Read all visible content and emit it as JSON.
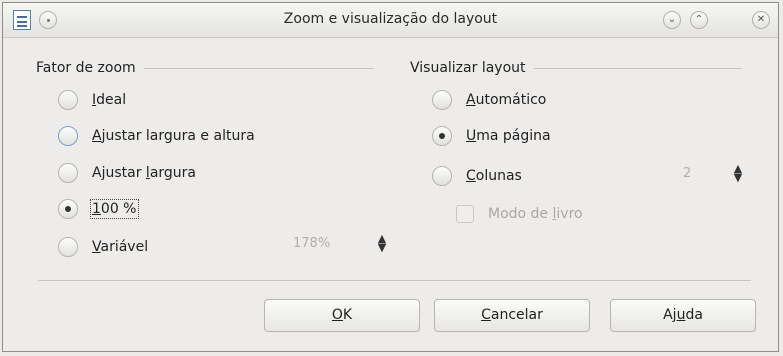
{
  "window": {
    "title": "Zoom e visualização do layout"
  },
  "zoom_group": {
    "title": "Fator de zoom",
    "options": [
      {
        "label_u": "I",
        "label_rest": "deal",
        "checked": false
      },
      {
        "label_u": "A",
        "label_rest": "justar largura e altura",
        "checked": false
      },
      {
        "label_pre": "Ajustar ",
        "label_u": "l",
        "label_rest": "argura",
        "checked": false
      },
      {
        "label_u": "1",
        "label_rest": "00 %",
        "checked": true
      },
      {
        "label_u": "V",
        "label_rest": "ariável",
        "checked": false
      }
    ],
    "variable_value": "178%"
  },
  "layout_group": {
    "title": "Visualizar layout",
    "options": [
      {
        "label_u": "A",
        "label_rest": "utomático",
        "checked": false
      },
      {
        "label_u": "U",
        "label_rest": "ma página",
        "checked": true
      },
      {
        "label_u": "C",
        "label_rest": "olunas",
        "checked": false
      }
    ],
    "columns_value": "2",
    "book_mode": {
      "label_pre": "Modo de ",
      "label_u": "l",
      "label_rest": "ivro",
      "checked": false
    }
  },
  "buttons": {
    "ok_u": "O",
    "ok_rest": "K",
    "cancel_u": "C",
    "cancel_rest": "ancelar",
    "help_pre": "Aj",
    "help_u": "u",
    "help_rest": "da"
  }
}
